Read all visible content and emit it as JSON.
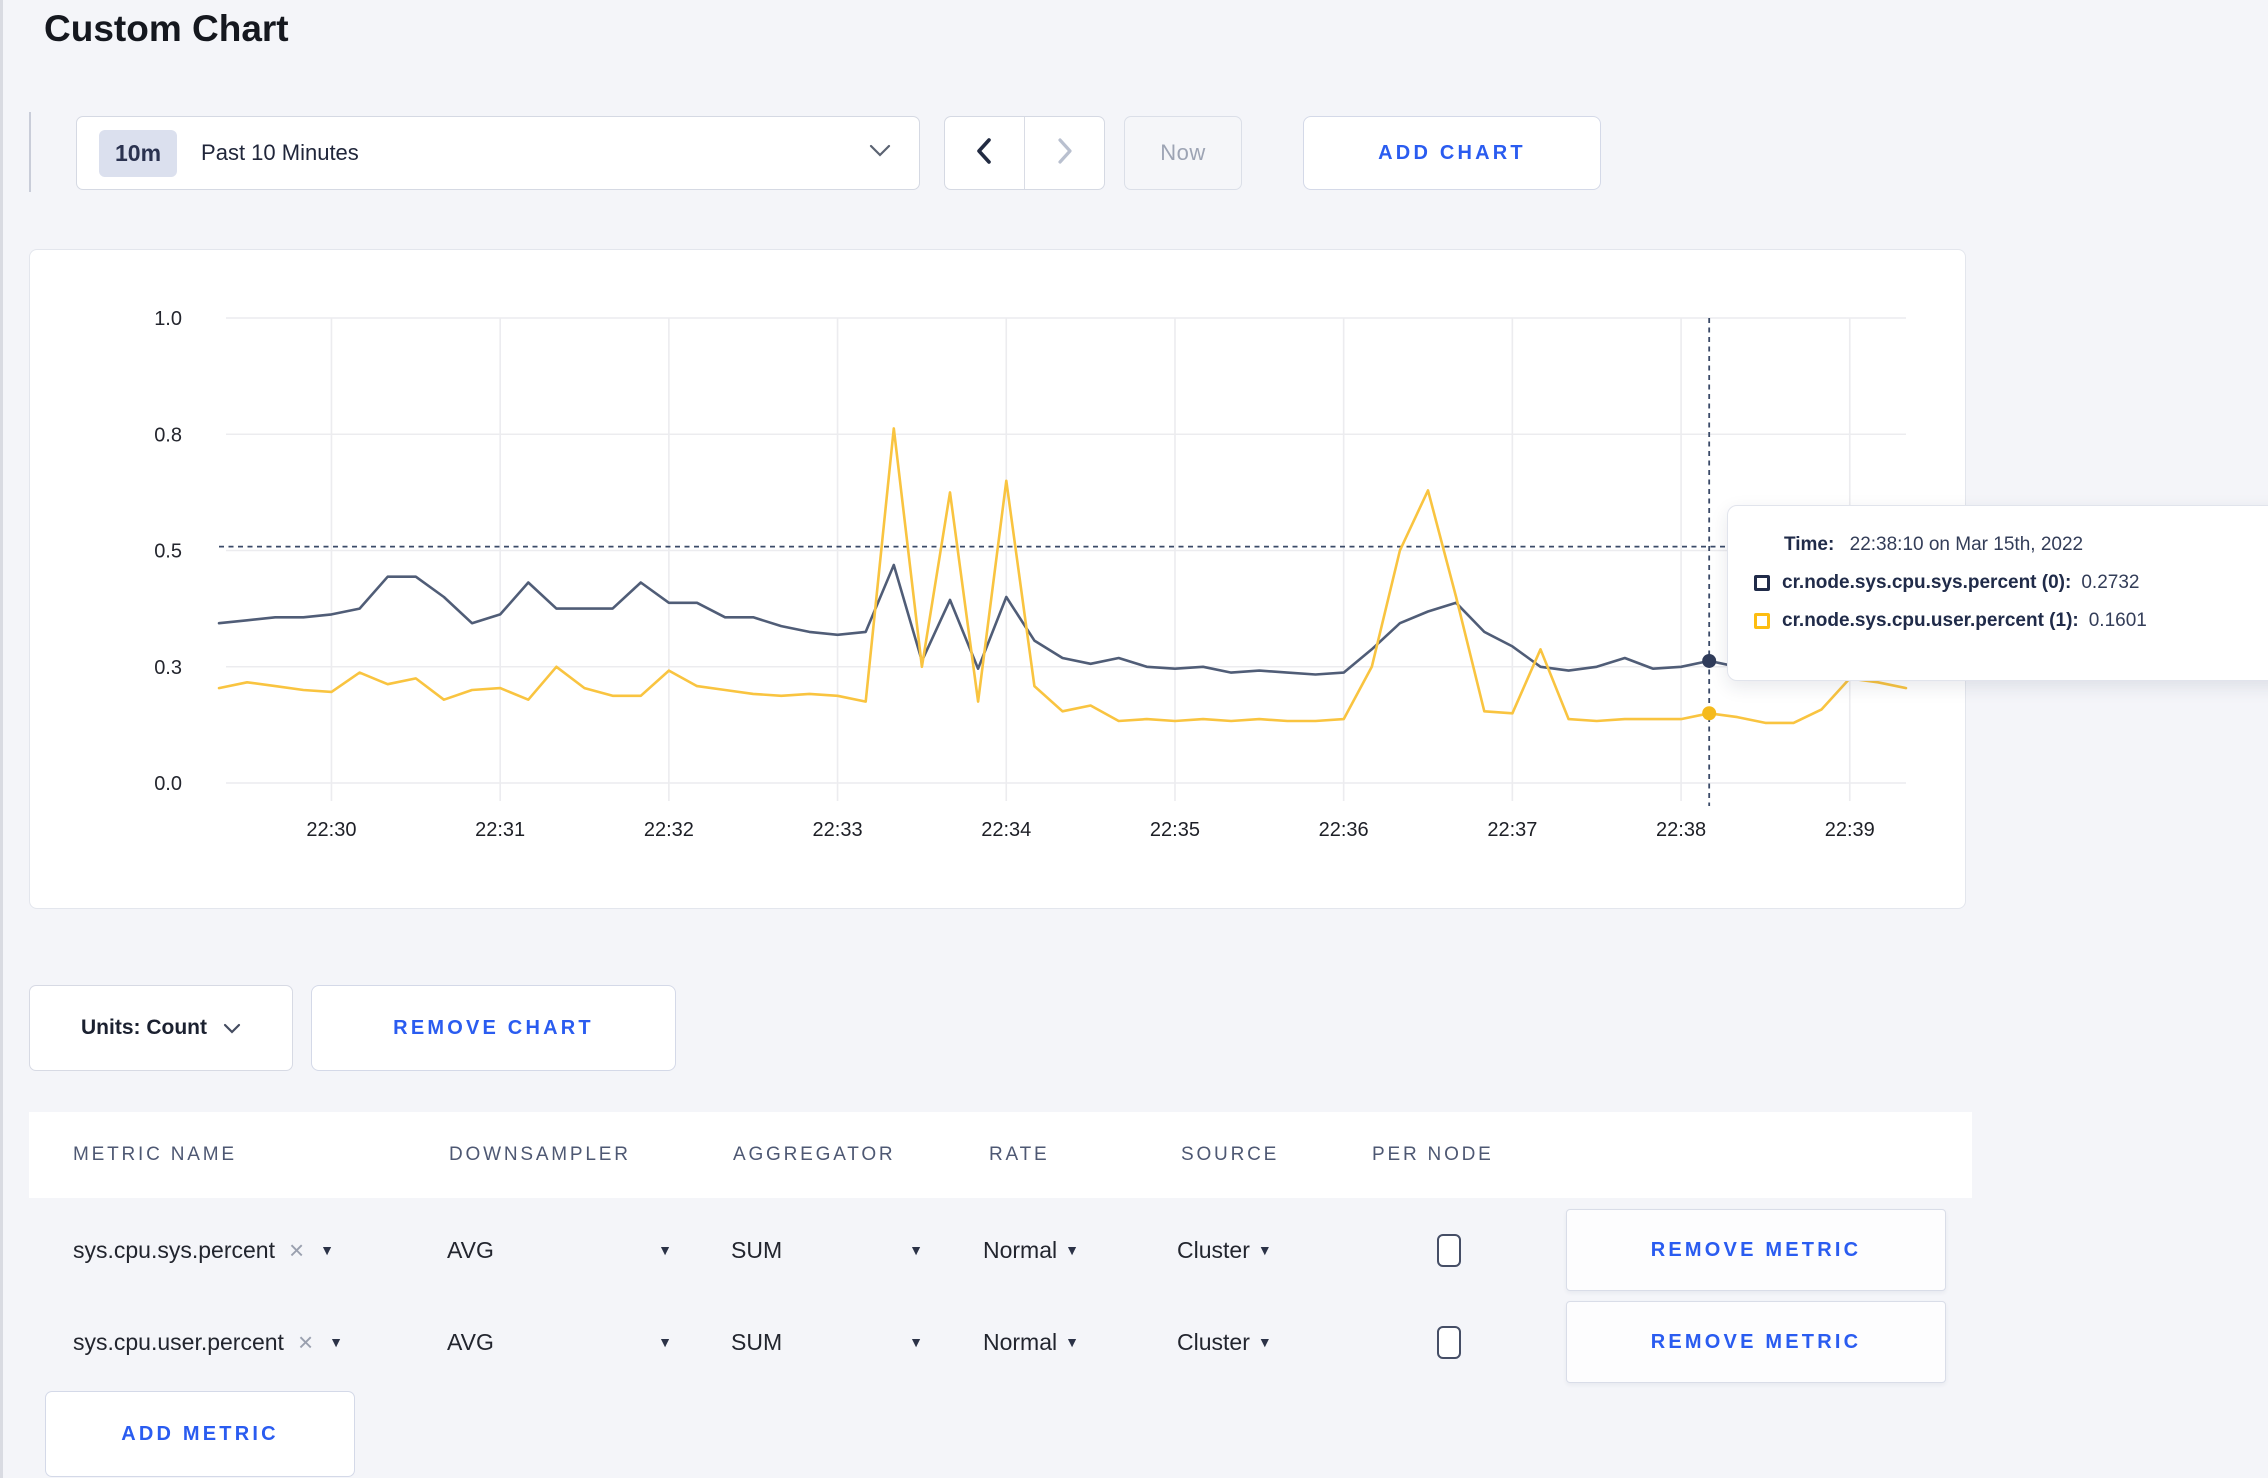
{
  "page_title": "Custom Chart",
  "colors": {
    "accent_blue": "#2a5cf0",
    "series_sys": "#505d77",
    "series_user": "#f9c440",
    "swatch_sys": "#202b49",
    "swatch_user": "#fdbd11",
    "crosshair": "#3a4a68",
    "gridline": "#ececef"
  },
  "toolbar": {
    "range_badge": "10m",
    "range_label": "Past 10 Minutes",
    "prev_icon": "chevron-left",
    "next_icon": "chevron-right",
    "now_label": "Now",
    "add_chart_label": "ADD CHART"
  },
  "tooltip": {
    "time_label": "Time:",
    "time_value": "22:38:10 on Mar 15th, 2022",
    "rows": [
      {
        "label": "cr.node.sys.cpu.sys.percent (0):",
        "value": "0.2732",
        "swatch": "#202b49"
      },
      {
        "label": "cr.node.sys.cpu.user.percent (1):",
        "value": "0.1601",
        "swatch": "#fdbd11"
      }
    ]
  },
  "chart_data": {
    "type": "line",
    "title": "",
    "xlabel": "",
    "ylabel": "",
    "x_start": "22:29:20",
    "x_interval_s": 10,
    "x_ticks": [
      "22:30",
      "22:31",
      "22:32",
      "22:33",
      "22:34",
      "22:35",
      "22:36",
      "22:37",
      "22:38",
      "22:39"
    ],
    "y_ticks": [
      0.0,
      0.3,
      0.5,
      0.8,
      1.0
    ],
    "y_tick_labels": [
      "0.0",
      "0.3",
      "0.5",
      "0.8",
      "1.0"
    ],
    "grid": true,
    "legend_position": "tooltip",
    "series": [
      {
        "name": "cr.node.sys.cpu.sys.percent",
        "color": "#505d77",
        "values": [
          0.375,
          0.38,
          0.385,
          0.385,
          0.39,
          0.4,
          0.455,
          0.455,
          0.42,
          0.375,
          0.39,
          0.445,
          0.4,
          0.4,
          0.4,
          0.445,
          0.41,
          0.41,
          0.385,
          0.385,
          0.37,
          0.36,
          0.355,
          0.36,
          0.475,
          0.31,
          0.415,
          0.295,
          0.42,
          0.345,
          0.315,
          0.305,
          0.315,
          0.3,
          0.295,
          0.3,
          0.285,
          0.29,
          0.285,
          0.28,
          0.285,
          0.33,
          0.375,
          0.395,
          0.41,
          0.36,
          0.335,
          0.3,
          0.29,
          0.3,
          0.315,
          0.295,
          0.3,
          0.31,
          0.3,
          0.295,
          0.3,
          0.295,
          0.3,
          0.3,
          0.295
        ]
      },
      {
        "name": "cr.node.sys.cpu.user.percent",
        "color": "#f9c440",
        "values": [
          0.245,
          0.26,
          0.25,
          0.24,
          0.235,
          0.285,
          0.255,
          0.27,
          0.215,
          0.24,
          0.245,
          0.215,
          0.3,
          0.245,
          0.225,
          0.225,
          0.29,
          0.25,
          0.24,
          0.23,
          0.225,
          0.23,
          0.225,
          0.21,
          0.81,
          0.3,
          0.65,
          0.21,
          0.68,
          0.25,
          0.185,
          0.2,
          0.16,
          0.165,
          0.16,
          0.165,
          0.16,
          0.165,
          0.16,
          0.16,
          0.165,
          0.3,
          0.5,
          0.655,
          0.42,
          0.185,
          0.18,
          0.33,
          0.165,
          0.16,
          0.165,
          0.165,
          0.165,
          0.18,
          0.17,
          0.155,
          0.155,
          0.19,
          0.27,
          0.26,
          0.245
        ]
      }
    ],
    "crosshair": {
      "time": "22:38:10",
      "x_index": 53,
      "y_value": 0.51,
      "markers": [
        {
          "series": 0,
          "value": 0.31,
          "color": "#303c5a"
        },
        {
          "series": 1,
          "value": 0.18,
          "color": "#f5ba1c"
        }
      ]
    }
  },
  "units_bar": {
    "units_label": "Units: Count",
    "remove_chart_label": "REMOVE CHART"
  },
  "metrics_table": {
    "headers": [
      "METRIC NAME",
      "DOWNSAMPLER",
      "AGGREGATOR",
      "RATE",
      "SOURCE",
      "PER NODE"
    ],
    "rows": [
      {
        "name": "sys.cpu.sys.percent",
        "close": "×",
        "downsampler": "AVG",
        "aggregator": "SUM",
        "rate": "Normal",
        "source": "Cluster",
        "per_node_checked": false,
        "remove_label": "REMOVE METRIC"
      },
      {
        "name": "sys.cpu.user.percent",
        "close": "×",
        "downsampler": "AVG",
        "aggregator": "SUM",
        "rate": "Normal",
        "source": "Cluster",
        "per_node_checked": false,
        "remove_label": "REMOVE METRIC"
      }
    ],
    "add_metric_label": "ADD METRIC"
  }
}
